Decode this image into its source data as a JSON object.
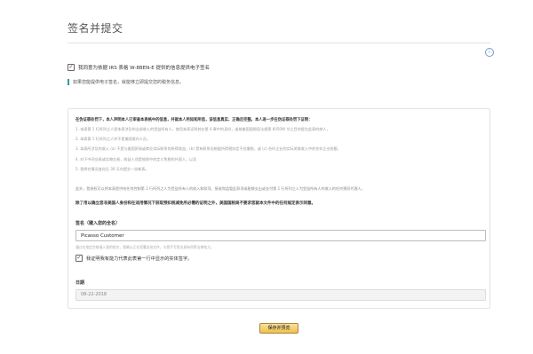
{
  "page": {
    "title": "签名并提交"
  },
  "consent": {
    "checked": true,
    "label": "我同意为依据 IRS 表格 W-8BEN-E 提供的信息提供电子签名"
  },
  "hint": {
    "text": "如果您能提供电子签名，就能够立即提交您的税务信息。"
  },
  "certification": {
    "heading": "在伪证罪处罚下，本人声明本人已审查本表格中的信息，并就本人所知和所信，该信息真实、正确且完整。本人进一步在伪证罪处罚下证明：",
    "items": [
      "1. 本表第 1 行所列之人是本表涉及的全部收入的受益所有人，使用本表证明其在第 4 章中的身份，或按美国国税局法规第 6050W 节之目的提交此表的商人，",
      "2. 本表第 1 行所列之人并不是美国境内人员，",
      "3. 本表所涉及的收入 (a) 不是与美国贸易或商业实际联系的所得收益，(b) 是有联系但根据所得税协定不应缴税，或 (c) 合伙企业的实际关联收入中的合伙企业份额，",
      "4. 对于中间交易或实物交易，收益人须是按照中的定义免税的外国人，以及",
      "5. 我将在情况变化后 30 天内提交一份新表。"
    ],
    "note": "此外，我授权可以将本表提供给任何控制第 1 行所列之人为受益所有人的收入和款项、接收和监管此款项或能够支出或支付第 1 行所列之人为受益所有人的收入的任何预扣代理人。",
    "warning": "除了用以确立您非美国人身份和在适用情况下获取预扣税减免所必需的证明之外，美国国税局不要求您就本文件中的任何规定表示同意。"
  },
  "signature": {
    "label": "签名（键入您的全名）",
    "value": "Picasso Customer",
    "hint": "通过在指定空格键入我的姓名，我确认正在签署这份文件，与我手写签名具有同等法律效力。",
    "capacity_checked": true,
    "capacity_label": "我证明我有能力代表此表第一行中显示的实体签字。"
  },
  "date": {
    "label": "日期",
    "value": "08-22-2018"
  },
  "actions": {
    "submit_label": "保存并预览"
  },
  "icons": {
    "info": "info-icon",
    "check": "check-icon"
  },
  "colors": {
    "accent_button": "#f0c14b",
    "hint_bar": "#2aa198"
  }
}
